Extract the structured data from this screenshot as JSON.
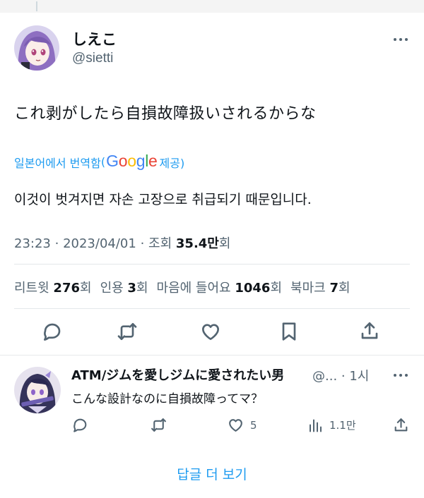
{
  "tweet": {
    "author_name": "しえこ",
    "author_handle": "@sietti",
    "text": "これ剥がしたら自損故障扱いされるからな",
    "translation": {
      "translated_from": "일본어에서 번역함",
      "provider": "Google",
      "provided_suffix": "제공)",
      "text": "이것이 벗겨지면 자손 고장으로 취급되기 때문입니다."
    },
    "meta": {
      "time": "23:23",
      "dot": "·",
      "date": "2023/04/01",
      "views_label": "조회",
      "views_count": "35.4만",
      "views_unit": "회"
    },
    "stats": {
      "retweets_label": "리트윗",
      "retweets_count": "276",
      "quotes_label": "인용",
      "quotes_count": "3",
      "likes_label": "마음에 들어요",
      "likes_count": "1046",
      "bookmarks_label": "북마크",
      "bookmarks_count": "7",
      "unit": "회"
    },
    "actions": [
      "reply-icon",
      "retweet-icon",
      "heart-icon",
      "bookmark-icon",
      "share-icon"
    ]
  },
  "reply": {
    "author_name": "ATM/ジムを愛しジムに愛されたい男",
    "handle_time": "@... · 1시",
    "text": "こんな設計なのに自損故障ってマ？",
    "likes_count": "5",
    "views_count": "1.1만"
  },
  "show_more_replies": "답글 더 보기",
  "colors": {
    "link": "#1d9bf0",
    "muted": "#536471",
    "text": "#0f1419",
    "avatar_hair": "#8e6fc1",
    "google_blue": "#4285f4",
    "google_red": "#ea4335",
    "google_yellow": "#fbbc05",
    "google_green": "#34a853"
  }
}
